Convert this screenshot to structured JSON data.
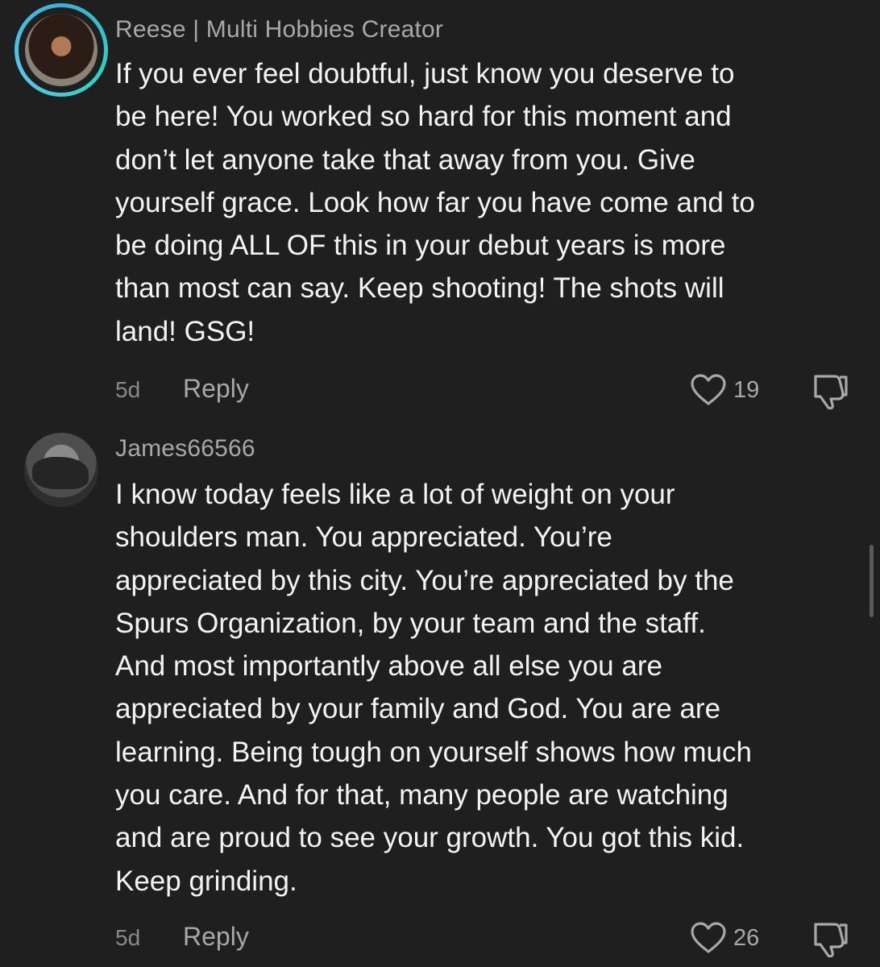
{
  "comments": [
    {
      "username": "Reese | Multi Hobbies Creator",
      "text": "If you ever feel doubtful, just know you deserve to\nbe here! You worked so hard for this moment and\ndon’t let anyone take that away from you. Give\nyourself grace. Look how far you have come and to\nbe doing ALL OF this in your debut years is more\nthan most can say. Keep shooting! The shots will\nland! GSG!",
      "time": "5d",
      "reply_label": "Reply",
      "likes": "19",
      "avatar_ring": true
    },
    {
      "username": "James66566",
      "text": "I know today feels like a lot of weight on your\nshoulders man. You appreciated. You’re\nappreciated by this city. You’re appreciated by the\nSpurs Organization, by your team and the staff.\nAnd most importantly above all else you are\nappreciated by your family and God. You are are\nlearning. Being tough on yourself shows how much\nyou care. And for that, many people are watching\nand are proud to see your growth. You got this kid.\nKeep grinding.",
      "time": "5d",
      "reply_label": "Reply",
      "likes": "26",
      "avatar_ring": false
    }
  ],
  "icons": {
    "like": "heart-outline-icon",
    "dislike": "thumbs-down-outline-icon"
  },
  "colors": {
    "background": "#1f1f1f",
    "text_primary": "#f3f3f3",
    "text_secondary": "#a8a8a8",
    "avatar_ring": "#3ab0d6"
  }
}
